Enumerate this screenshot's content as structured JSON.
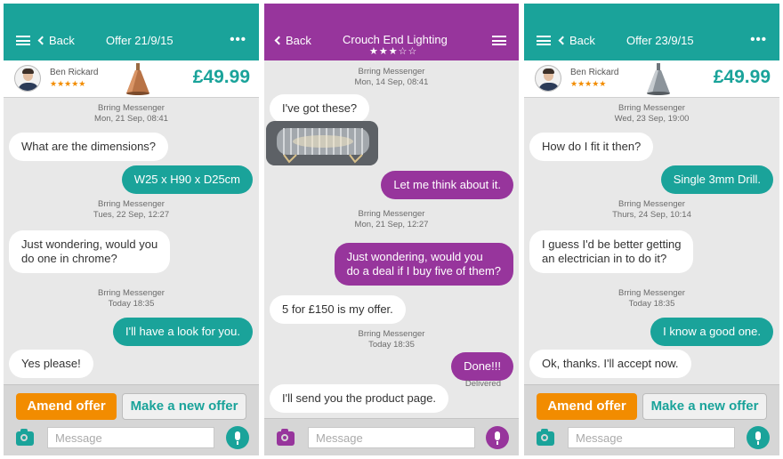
{
  "colors": {
    "teal": "#1aa39a",
    "purple": "#97359c",
    "orange": "#f28c00",
    "chat_bg": "#e8e8e8"
  },
  "phone1": {
    "back": "Back",
    "title": "Offer 21/9/15",
    "more": "•••",
    "seller": {
      "name": "Ben Rickard",
      "stars": "★★★★★"
    },
    "price": "£49.99",
    "sys": [
      {
        "label": "Brring Messenger",
        "time": "Mon, 21 Sep, 08:41"
      },
      {
        "label": "Brring Messenger",
        "time": "Tues, 22 Sep, 12:27"
      },
      {
        "label": "Brring Messenger",
        "time": "Today 18:35"
      }
    ],
    "messages": [
      "What are the dimensions?",
      "W25 x H90 x D25cm",
      "Just wondering, would you",
      "do one in chrome?",
      "I'll have a look for you.",
      "Yes please!"
    ],
    "amend": "Amend offer",
    "new_offer": "Make a new offer",
    "placeholder": "Message"
  },
  "phone2": {
    "back": "Back",
    "title": "Crouch End Lighting",
    "stars": "★★★☆☆",
    "sys": [
      {
        "label": "Brring Messenger",
        "time": "Mon, 14 Sep, 08:41"
      },
      {
        "label": "Brring Messenger",
        "time": "Mon, 21 Sep, 12:27"
      },
      {
        "label": "Brring Messenger",
        "time": "Today 18:35"
      }
    ],
    "messages": [
      "I've got these?",
      "Let me think about it.",
      "Just wondering, would you",
      "do a deal if I buy five of them?",
      "5 for £150 is my offer.",
      "Done!!!",
      "I'll send you the product page."
    ],
    "delivered": "Delivered",
    "placeholder": "Message"
  },
  "phone3": {
    "back": "Back",
    "title": "Offer 23/9/15",
    "more": "•••",
    "seller": {
      "name": "Ben Rickard",
      "stars": "★★★★★"
    },
    "price": "£49.99",
    "sys": [
      {
        "label": "Brring Messenger",
        "time": "Wed, 23 Sep, 19:00"
      },
      {
        "label": "Brring Messenger",
        "time": "Thurs, 24 Sep, 10:14"
      },
      {
        "label": "Brring Messenger",
        "time": "Today 18:35"
      }
    ],
    "messages": [
      "How do I fit it then?",
      "Single 3mm Drill.",
      "I guess I'd be better getting",
      "an electrician in to do it?",
      "I know a good one.",
      "Ok, thanks. I'll accept now."
    ],
    "amend": "Amend offer",
    "new_offer": "Make a new offer",
    "placeholder": "Message"
  }
}
